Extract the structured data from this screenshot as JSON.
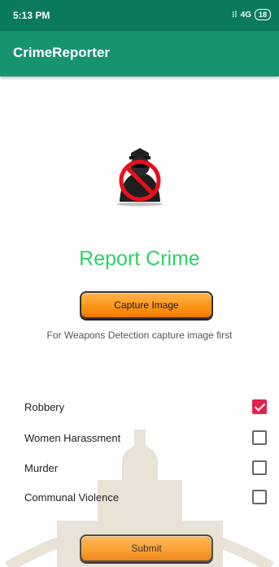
{
  "status_bar": {
    "time": "5:13 PM",
    "signal": "4G",
    "battery": "18"
  },
  "app_bar": {
    "title": "CrimeReporter"
  },
  "main": {
    "title": "Report Crime",
    "capture_button": "Capture Image",
    "hint": "For Weapons Detection capture image first",
    "options": [
      {
        "label": "Robbery",
        "checked": true
      },
      {
        "label": "Women Harassment",
        "checked": false
      },
      {
        "label": "Murder",
        "checked": false
      },
      {
        "label": "Communal Violence",
        "checked": false
      }
    ],
    "submit_button": "Submit"
  },
  "colors": {
    "accent_green": "#2fd065",
    "app_bar": "#16936f",
    "status_bar": "#0a7a5f",
    "checkbox_checked": "#e0234d",
    "button_orange": "#ff9618"
  }
}
